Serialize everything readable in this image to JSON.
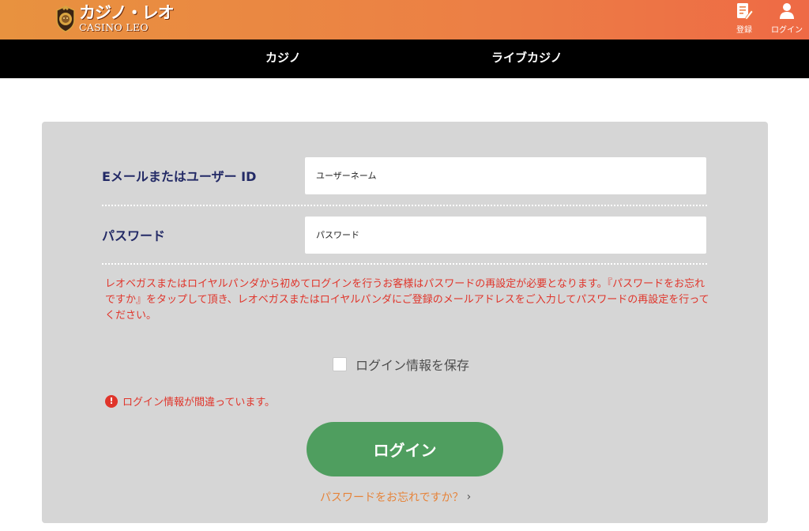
{
  "header": {
    "logo_jp": "カジノ・レオ",
    "logo_en": "CASINO LEO",
    "logo_icon": "lion-crest-icon",
    "register_label": "登録",
    "register_icon": "register-form-icon",
    "login_label": "ログイン",
    "login_icon": "user-icon",
    "gradient_colors": [
      "#e8923f",
      "#ee6a45"
    ]
  },
  "nav": {
    "items": [
      {
        "label": "カジノ"
      },
      {
        "label": "ライブカジノ"
      }
    ]
  },
  "form": {
    "email_label": "Eメールまたはユーザー ID",
    "email_placeholder": "ユーザーネーム",
    "password_label": "パスワード",
    "password_placeholder": "パスワード",
    "notice": "レオベガスまたはロイヤルパンダから初めてログインを行うお客様はパスワードの再設定が必要となります。『パスワードをお忘れですか』をタップして頂き、レオベガスまたはロイヤルパンダにご登録のメールアドレスをご入力してパスワードの再設定を行ってください。",
    "remember_label": "ログイン情報を保存",
    "remember_checked": false,
    "error_message": "ログイン情報が間違っています。",
    "error_icon": "exclamation-icon",
    "login_button": "ログイン",
    "forgot_link": "パスワードをお忘れですか？",
    "forgot_icon": "chevron-right-icon"
  },
  "colors": {
    "label": "#232a66",
    "error": "#e0352b",
    "button": "#4f9e5f",
    "link": "#e6843b",
    "panel": "#d6d6d6"
  }
}
